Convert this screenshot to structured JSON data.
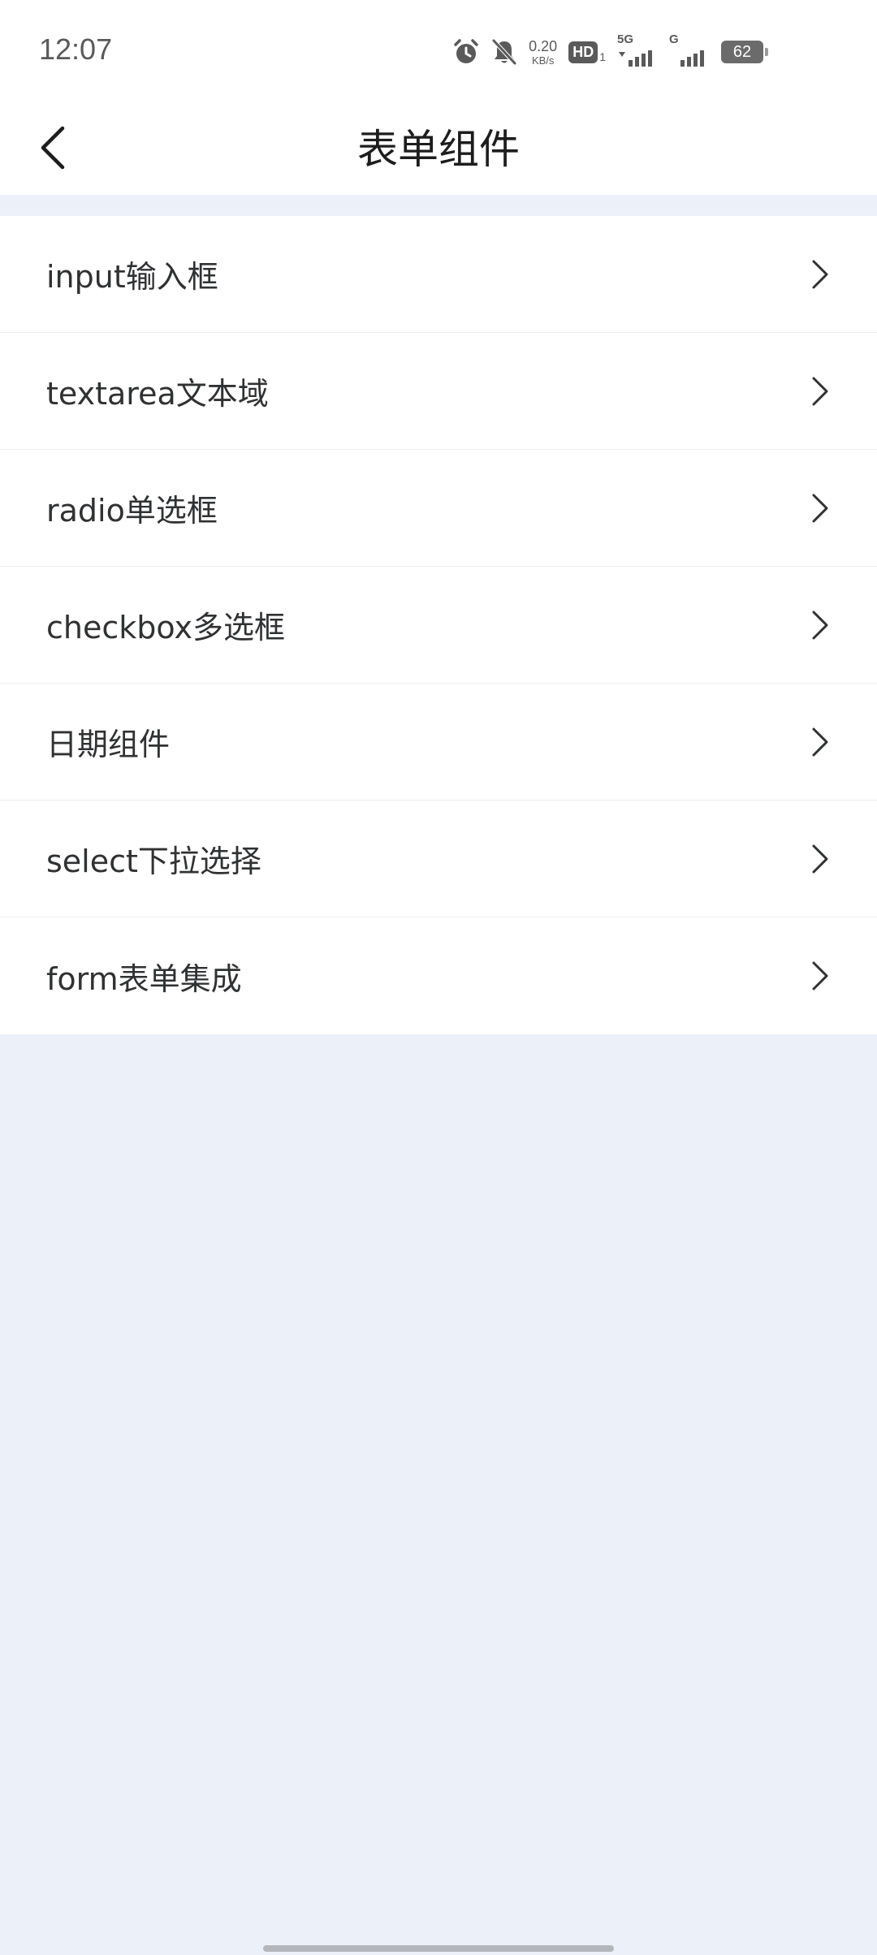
{
  "status_bar": {
    "time": "12:07",
    "net_speed_value": "0.20",
    "net_speed_unit": "KB/s",
    "hd_label": "HD",
    "hd_sub": "1",
    "sim1_label": "5G",
    "sim2_label": "G",
    "battery": "62",
    "icons": [
      "alarm-icon",
      "mute-icon",
      "signal-icon",
      "battery-icon"
    ]
  },
  "header": {
    "title": "表单组件",
    "back_icon": "chevron-left-icon"
  },
  "list": {
    "items": [
      {
        "label": "input输入框"
      },
      {
        "label": "textarea文本域"
      },
      {
        "label": "radio单选框"
      },
      {
        "label": "checkbox多选框"
      },
      {
        "label": "日期组件"
      },
      {
        "label": "select下拉选择"
      },
      {
        "label": "form表单集成"
      }
    ],
    "item_icon": "chevron-right-icon"
  },
  "colors": {
    "page_background": "#ecf0f9",
    "card_background": "#ffffff",
    "text_primary": "#303133"
  }
}
